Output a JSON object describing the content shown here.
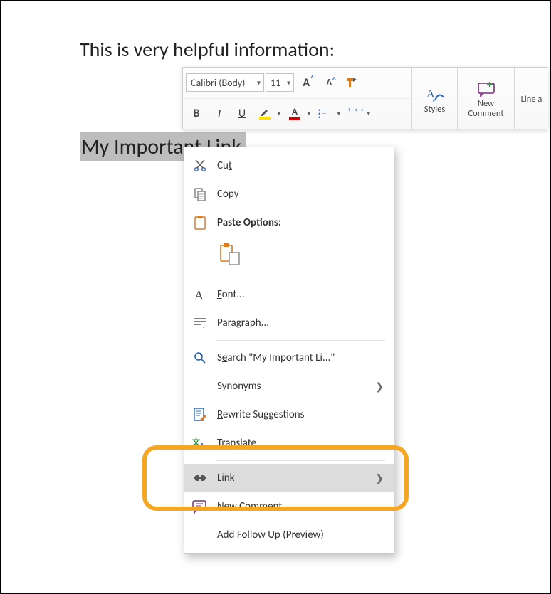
{
  "document": {
    "intro_text": "This is very helpful information:",
    "selected_text": "My Important Link"
  },
  "mini_toolbar": {
    "font_name": "Calibri (Body)",
    "font_size": "11",
    "styles_label": "Styles",
    "new_comment_label_line1": "New",
    "new_comment_label_line2": "Comment",
    "line_and_label": "Line a"
  },
  "context_menu": {
    "cut": "Cut",
    "copy": "Copy",
    "paste_options": "Paste Options:",
    "font": "Font...",
    "paragraph": "Paragraph...",
    "search": "Search \"My Important Li...\"",
    "synonyms": "Synonyms",
    "rewrite": "Rewrite Suggestions",
    "translate": "Translate",
    "link": "Link",
    "new_comment": "New Comment",
    "add_follow_up": "Add Follow Up (Preview)"
  },
  "colors": {
    "highlight": "#ffe200",
    "font_color": "#d30000",
    "accent_orange": "#e07b1b",
    "callout": "#f5a623"
  }
}
